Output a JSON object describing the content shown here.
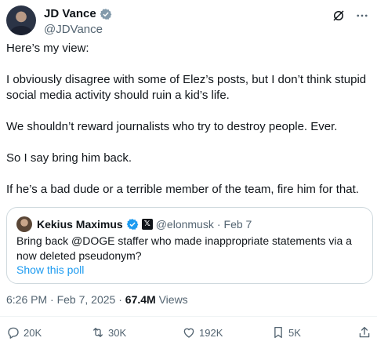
{
  "author": {
    "name": "JD Vance",
    "handle": "@JDVance"
  },
  "tweet": {
    "paragraphs": [
      "Here’s my view:",
      "I obviously disagree with some of Elez’s posts, but I don’t think stupid social media activity should ruin a kid’s life.",
      "We shouldn’t reward journalists who try to destroy people. Ever.",
      "So I say bring him back.",
      "If he’s a bad dude or a terrible member of the team, fire him for that."
    ],
    "time": "6:26 PM",
    "separator": "·",
    "date": "Feb 7, 2025",
    "views_count": "67.4M",
    "views_label": "Views"
  },
  "quote": {
    "name": "Kekius Maximus",
    "handle": "@elonmusk",
    "separator": "·",
    "date": "Feb 7",
    "text": "Bring back @DOGE staffer who made inappropriate statements via a now deleted pseudonym?",
    "poll_link": "Show this poll"
  },
  "actions": {
    "replies": "20K",
    "reposts": "30K",
    "likes": "192K",
    "bookmarks": "5K"
  },
  "colors": {
    "text": "#0f1419",
    "secondary": "#536471",
    "accent": "#1d9bf0",
    "border": "#cfd9de"
  },
  "icons": [
    "verified-badge-icon",
    "grok-icon",
    "more-icon",
    "x-logo-badge-icon",
    "reply-icon",
    "repost-icon",
    "like-icon",
    "bookmark-icon",
    "share-icon"
  ]
}
